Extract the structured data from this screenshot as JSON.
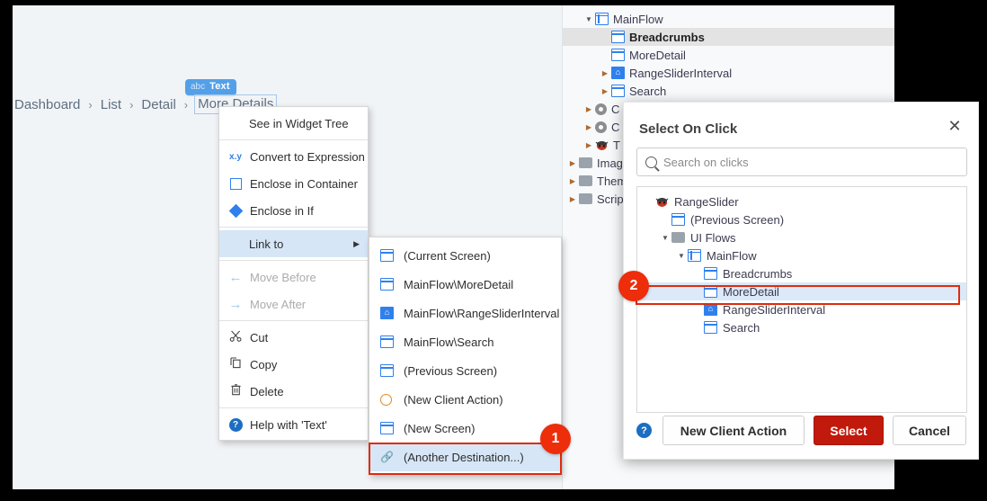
{
  "canvas": {
    "breadcrumb": {
      "items": [
        "Dashboard",
        "List",
        "Detail",
        "More Details"
      ],
      "separator": "›",
      "selected_index": 3
    },
    "widget_badge": {
      "kind": "abc",
      "label": "Text"
    }
  },
  "widget_tree": {
    "nodes": [
      {
        "label": "MainFlow",
        "icon": "flow-icon",
        "indent": 1,
        "twisty": "open",
        "bold": false,
        "selected": false
      },
      {
        "label": "Breadcrumbs",
        "icon": "screen-icon",
        "indent": 2,
        "twisty": "none",
        "bold": true,
        "selected": true
      },
      {
        "label": "MoreDetail",
        "icon": "screen-icon",
        "indent": 2,
        "twisty": "none",
        "bold": false,
        "selected": false
      },
      {
        "label": "RangeSliderInterval",
        "icon": "home-icon",
        "indent": 2,
        "twisty": "closed",
        "bold": false,
        "selected": false
      },
      {
        "label": "Search",
        "icon": "screen-icon",
        "indent": 2,
        "twisty": "closed",
        "bold": false,
        "selected": false
      },
      {
        "label": "C",
        "icon": "circle-icon",
        "indent": 1,
        "twisty": "closed",
        "bold": false,
        "selected": false
      },
      {
        "label": "C",
        "icon": "circle-icon",
        "indent": 1,
        "twisty": "closed",
        "bold": false,
        "selected": false
      },
      {
        "label": "T",
        "icon": "bug-icon",
        "indent": 1,
        "twisty": "closed",
        "bold": false,
        "selected": false
      },
      {
        "label": "Imag",
        "icon": "folder-icon",
        "indent": 0,
        "twisty": "closed",
        "bold": false,
        "selected": false
      },
      {
        "label": "Them",
        "icon": "folder-icon",
        "indent": 0,
        "twisty": "closed",
        "bold": false,
        "selected": false
      },
      {
        "label": "Scrip",
        "icon": "folder-icon",
        "indent": 0,
        "twisty": "closed",
        "bold": false,
        "selected": false
      }
    ]
  },
  "context_menu": {
    "items": [
      {
        "label": "See in Widget Tree",
        "icon": "none",
        "state": "normal",
        "kind": "plain"
      },
      {
        "type": "separator"
      },
      {
        "label": "Convert to Expression",
        "icon": "xy-icon",
        "state": "normal",
        "kind": "plain"
      },
      {
        "label": "Enclose in Container",
        "icon": "square-icon",
        "state": "normal",
        "kind": "plain"
      },
      {
        "label": "Enclose in If",
        "icon": "diamond-icon",
        "state": "normal",
        "kind": "plain"
      },
      {
        "type": "separator"
      },
      {
        "label": "Link to",
        "icon": "none",
        "state": "highlight",
        "kind": "submenu",
        "arrow": "▶"
      },
      {
        "type": "separator"
      },
      {
        "label": "Move Before",
        "icon": "arrow-left-icon",
        "state": "disabled",
        "kind": "plain"
      },
      {
        "label": "Move After",
        "icon": "arrow-right-icon",
        "state": "disabled",
        "kind": "plain"
      },
      {
        "type": "separator"
      },
      {
        "label": "Cut",
        "icon": "scissors-icon",
        "state": "normal",
        "kind": "plain"
      },
      {
        "label": "Copy",
        "icon": "copy-icon",
        "state": "normal",
        "kind": "plain"
      },
      {
        "label": "Delete",
        "icon": "trash-icon",
        "state": "normal",
        "kind": "plain"
      },
      {
        "type": "separator"
      },
      {
        "label": "Help with 'Text'",
        "icon": "help-icon",
        "state": "normal",
        "kind": "plain"
      }
    ]
  },
  "submenu": {
    "items": [
      {
        "label": "(Current Screen)",
        "icon": "screen-icon",
        "highlight": false
      },
      {
        "label": "MainFlow\\MoreDetail",
        "icon": "screen-icon",
        "highlight": false
      },
      {
        "label": "MainFlow\\RangeSliderInterval",
        "icon": "home-icon",
        "highlight": false
      },
      {
        "label": "MainFlow\\Search",
        "icon": "screen-icon",
        "highlight": false
      },
      {
        "label": "(Previous Screen)",
        "icon": "screen-icon",
        "highlight": false
      },
      {
        "label": "(New Client Action)",
        "icon": "circle-orange-icon",
        "highlight": false
      },
      {
        "label": "(New Screen)",
        "icon": "screen-icon",
        "highlight": false
      },
      {
        "label": "(Another Destination...)",
        "icon": "link-icon",
        "highlight": true
      }
    ]
  },
  "callouts": [
    {
      "number": "1",
      "target": "another-destination-item"
    },
    {
      "number": "2",
      "target": "dialog-tree-moredetail"
    }
  ],
  "dialog": {
    "title": "Select On Click",
    "close_label": "✕",
    "search": {
      "placeholder": "Search on clicks",
      "value": ""
    },
    "tree": [
      {
        "label": "RangeSlider",
        "icon": "bug-icon",
        "indent": 0,
        "twisty": "none",
        "selected": false
      },
      {
        "label": "(Previous Screen)",
        "icon": "screen-icon",
        "indent": 1,
        "twisty": "none",
        "selected": false
      },
      {
        "label": "UI Flows",
        "icon": "folder-icon",
        "indent": 1,
        "twisty": "open",
        "selected": false
      },
      {
        "label": "MainFlow",
        "icon": "flow-icon",
        "indent": 2,
        "twisty": "open",
        "selected": false
      },
      {
        "label": "Breadcrumbs",
        "icon": "screen-icon",
        "indent": 3,
        "twisty": "none",
        "selected": false
      },
      {
        "label": "MoreDetail",
        "icon": "screen-icon",
        "indent": 3,
        "twisty": "none",
        "selected": true
      },
      {
        "label": "RangeSliderInterval",
        "icon": "home-icon",
        "indent": 3,
        "twisty": "none",
        "selected": false
      },
      {
        "label": "Search",
        "icon": "screen-icon",
        "indent": 3,
        "twisty": "none",
        "selected": false
      }
    ],
    "footer": {
      "help_label": "?",
      "new_client_action_label": "New Client Action",
      "select_label": "Select",
      "cancel_label": "Cancel"
    }
  },
  "colors": {
    "accent_blue": "#2f80ed",
    "callout_red": "#ee2d0a",
    "highlight_red": "#e02b0c",
    "primary_button_red": "#c1190b",
    "selection_blue": "#dbe9f8",
    "menu_highlight": "#d6e6f7",
    "canvas_bg": "#f1f4f7"
  }
}
